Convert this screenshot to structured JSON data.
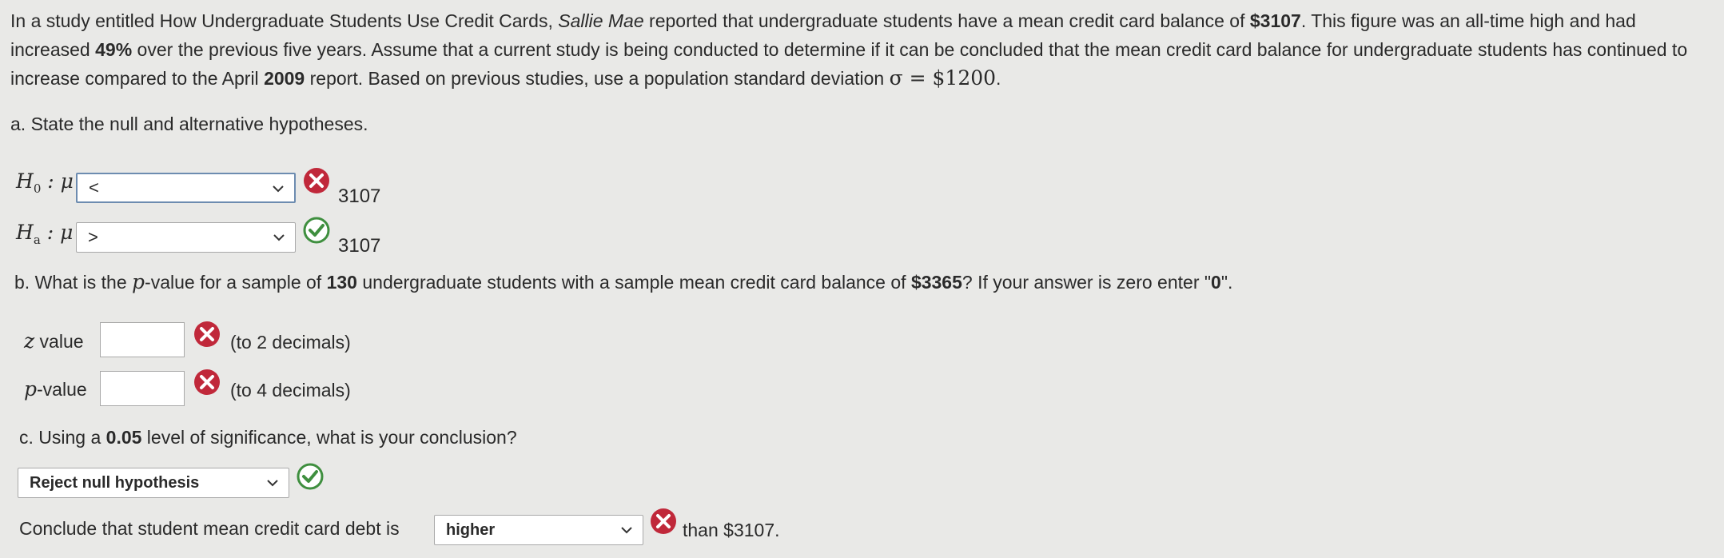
{
  "intro": {
    "p1": "In a study entitled How Undergraduate Students Use Credit Cards, ",
    "p1_italic": "Sallie Mae",
    "p2": " reported that undergraduate students have a mean credit card balance of ",
    "balance": "$3107",
    "p3": ". This figure was an all-time high and had increased ",
    "pct": "49%",
    "p4": " over the previous five years. Assume that a current study is being conducted to determine if it can be concluded that the mean credit card balance for undergraduate students has continued to increase compared to the April ",
    "year": "2009",
    "p5": " report. Based on previous studies, use a population standard deviation ",
    "sigma": "σ = $1200",
    "p6": "."
  },
  "part_a": {
    "question": "a. State the null and alternative hypotheses.",
    "h0_label": "H",
    "h0_sub": "0",
    "h0_mu": " : μ",
    "h0_value": "<",
    "h0_rhs": "3107",
    "ha_label": "H",
    "ha_sub": "a",
    "ha_mu": " : μ",
    "ha_value": ">",
    "ha_rhs": "3107"
  },
  "part_b": {
    "q1": "b. What is the ",
    "q_p": "p",
    "q2": "-value for a sample of ",
    "n": "130",
    "q3": " undergraduate students with a sample mean credit card balance of ",
    "xbar": "$3365",
    "q4": "? If your answer is zero enter \"",
    "zero": "0",
    "q5": "\".",
    "z_label": "z",
    "z_label2": " value",
    "z_value": "",
    "z_hint": "(to 2 decimals)",
    "p_label": "p",
    "p_label2": "-value",
    "p_value": "",
    "p_hint": "(to 4 decimals)"
  },
  "part_c": {
    "q1": "c. Using a ",
    "alpha": "0.05",
    "q2": " level of significance, what is your conclusion?",
    "decision": "Reject null hypothesis",
    "conclude_pre": "Conclude that student mean credit card debt is",
    "direction": "higher",
    "conclude_post": "than $3107."
  },
  "status_colors": {
    "wrong": "#c0283a",
    "correct": "#3f8f3f"
  }
}
